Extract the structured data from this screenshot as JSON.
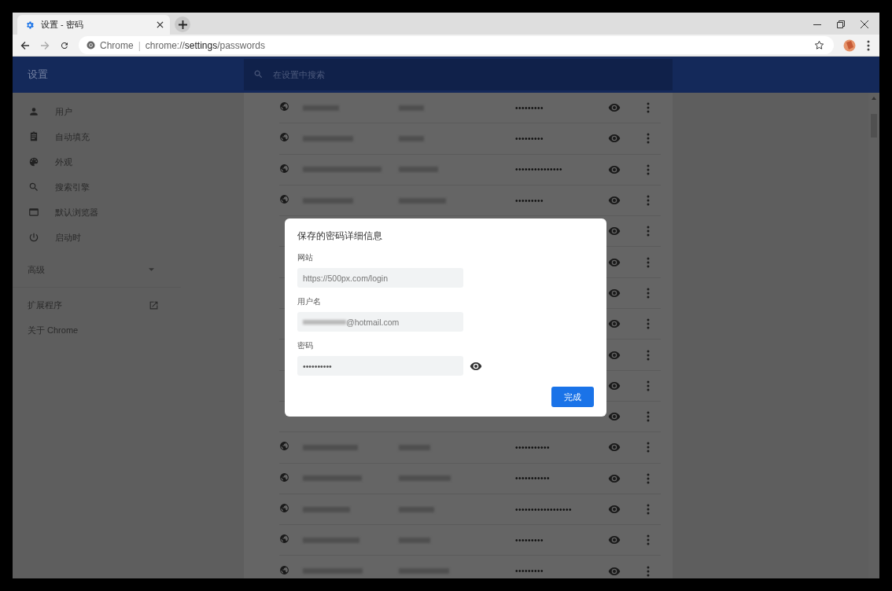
{
  "tab": {
    "title": "设置 - 密码"
  },
  "address": {
    "chip": "Chrome",
    "separator": "|",
    "scheme": "chrome://",
    "host": "settings",
    "path": "/passwords"
  },
  "header": {
    "title": "设置",
    "search_placeholder": "在设置中搜索"
  },
  "sidebar": {
    "items": [
      {
        "label": "用户"
      },
      {
        "label": "自动填充"
      },
      {
        "label": "外观"
      },
      {
        "label": "搜索引擎"
      },
      {
        "label": "默认浏览器"
      },
      {
        "label": "启动时"
      }
    ],
    "advanced": {
      "label": "高级",
      "expanded": false
    },
    "links": [
      {
        "label": "扩展程序",
        "external": true
      },
      {
        "label": "关于 Chrome",
        "external": false
      }
    ]
  },
  "passwords": [
    {
      "password": "•••••••••"
    },
    {
      "password": "•••••••••"
    },
    {
      "password": "•••••••••••••••"
    },
    {
      "password": "•••••••••"
    },
    {
      "covered": true
    },
    {
      "covered": true
    },
    {
      "covered": true
    },
    {
      "covered": true
    },
    {
      "covered": true
    },
    {
      "covered": true
    },
    {
      "covered": true
    },
    {
      "password": "•••••••••••"
    },
    {
      "password": "•••••••••••"
    },
    {
      "password": "••••••••••••••••••"
    },
    {
      "password": "•••••••••"
    },
    {
      "password": "•••••••••"
    }
  ],
  "dialog": {
    "title": "保存的密码详细信息",
    "fields": [
      {
        "label": "网站",
        "value": "https://500px.com/login",
        "kind": "url"
      },
      {
        "label": "用户名",
        "value": "@hotmail.com",
        "kind": "username"
      },
      {
        "label": "密码",
        "value": "••••••••••",
        "kind": "password"
      }
    ],
    "button": "完成"
  }
}
